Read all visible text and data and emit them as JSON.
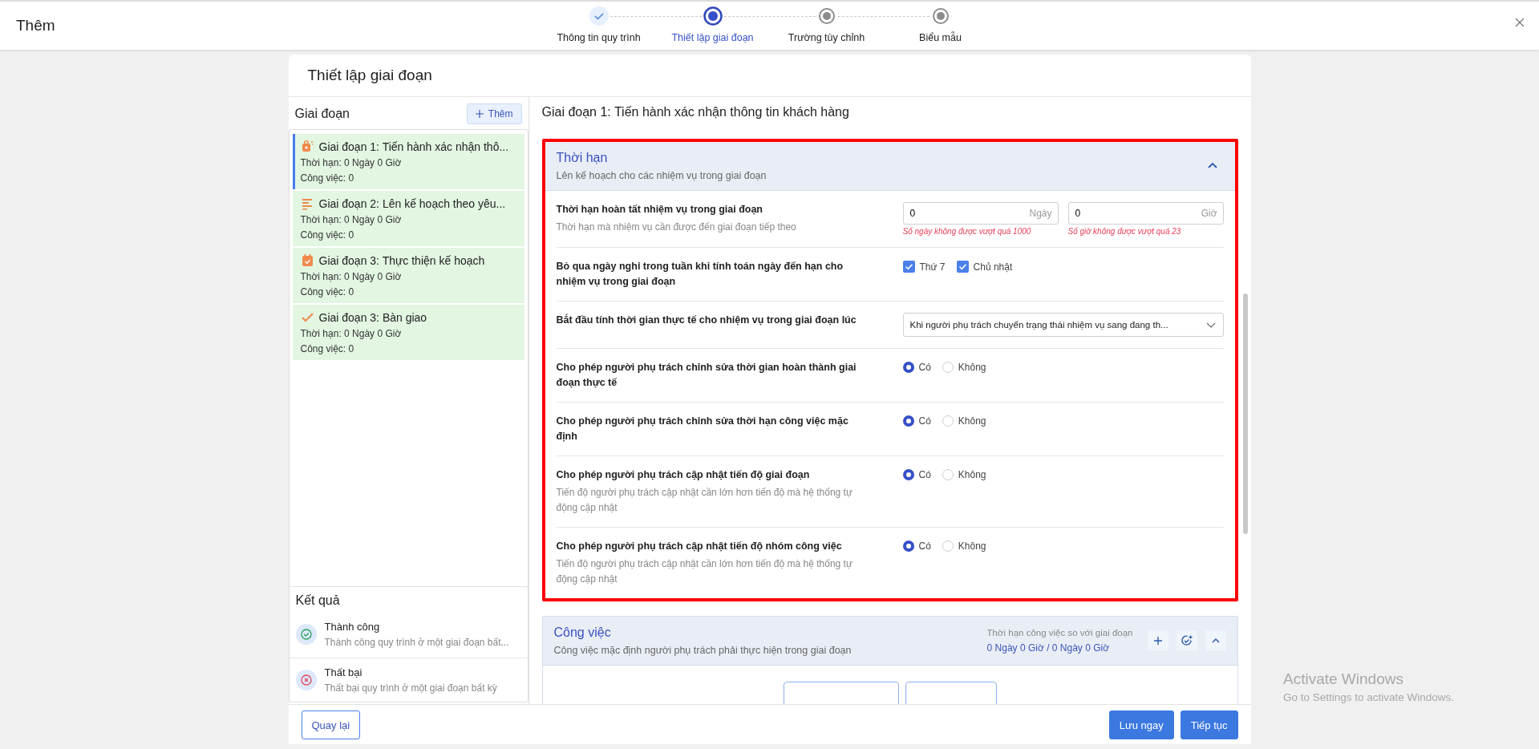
{
  "window": {
    "title": "Thêm"
  },
  "stepper": [
    {
      "label": "Thông tin quy trình",
      "kind": "done"
    },
    {
      "label": "Thiết lập giai đoạn",
      "kind": "active"
    },
    {
      "label": "Trường tùy chỉnh",
      "kind": "pending"
    },
    {
      "label": "Biểu mẫu",
      "kind": "pending"
    }
  ],
  "page_title": "Thiết lập giai đoạn",
  "stages_panel": {
    "title": "Giai đoạn",
    "add_button": "Thêm",
    "stages": [
      {
        "kind": "bag",
        "title": "Giai đoạn 1: Tiến hành xác nhận thô...",
        "duration": "Thời hạn: 0 Ngày 0 Giờ",
        "tasks": "Công việc: 0",
        "selected": true
      },
      {
        "kind": "list",
        "title": "Giai đoạn 2: Lên kế hoạch theo yêu...",
        "duration": "Thời hạn: 0 Ngày 0 Giờ",
        "tasks": "Công việc: 0",
        "selected": false
      },
      {
        "kind": "calendar",
        "title": "Giai đoạn 3: Thực thiện kế hoạch",
        "duration": "Thời hạn: 0 Ngày 0 Giờ",
        "tasks": "Công việc: 0",
        "selected": false
      },
      {
        "kind": "check",
        "title": "Giai đoạn 3: Bàn giao",
        "duration": "Thời hạn: 0 Ngày 0 Giờ",
        "tasks": "Công việc: 0",
        "selected": false
      }
    ]
  },
  "results": {
    "title": "Kết quả",
    "items": [
      {
        "kind": "success",
        "title": "Thành công",
        "description": "Thành công quy trình ở một giai đoạn bất..."
      },
      {
        "kind": "failure",
        "title": "Thất bại",
        "description": "Thất bại quy trình ở một giai đoạn bất kỳ"
      }
    ]
  },
  "detail": {
    "title": "Giai đoạn 1: Tiến hành xác nhận thông tin khách hàng",
    "deadline_section": {
      "title": "Thời hạn",
      "subtitle": "Lên kế hoạch cho các nhiệm vụ trong giai đoạn",
      "expanded": true,
      "highlighted": true,
      "rows": [
        {
          "kind": "inputs",
          "label": "Thời hạn hoàn tất nhiệm vụ trong giai đoạn",
          "hint": "Thời hạn mà nhiệm vụ cần được đến giai đoạn tiếp theo",
          "inputs": [
            {
              "value": "0",
              "unit": "Ngày",
              "error": "Số ngày không được vượt quá 1000"
            },
            {
              "value": "0",
              "unit": "Giờ",
              "error": "Số giờ không được vượt quá 23"
            }
          ]
        },
        {
          "kind": "checkboxes",
          "label": "Bỏ qua ngày nghỉ trong tuần khi tính toán ngày đến hạn cho nhiệm vụ trong giai đoạn",
          "options": [
            {
              "label": "Thứ 7",
              "checked": true
            },
            {
              "label": "Chủ nhật",
              "checked": true
            }
          ]
        },
        {
          "kind": "select",
          "label": "Bắt đầu tính thời gian thực tế cho nhiệm vụ trong giai đoạn lúc",
          "value": "Khi người phụ trách chuyển trạng thái nhiệm vụ sang đang th..."
        },
        {
          "kind": "radios",
          "label": "Cho phép người phụ trách chỉnh sửa thời gian hoàn thành giai đoạn thực tế",
          "options": [
            {
              "label": "Có",
              "selected": true
            },
            {
              "label": "Không",
              "selected": false
            }
          ]
        },
        {
          "kind": "radios",
          "label": "Cho phép người phụ trách chỉnh sửa thời hạn công việc mặc định",
          "options": [
            {
              "label": "Có",
              "selected": true
            },
            {
              "label": "Không",
              "selected": false
            }
          ]
        },
        {
          "kind": "radios",
          "label": "Cho phép người phụ trách cập nhật tiến độ giai đoạn",
          "hint": "Tiến độ người phụ trách cập nhật cần lớn hơn tiến độ mà hệ thống tự động cập nhật",
          "options": [
            {
              "label": "Có",
              "selected": true
            },
            {
              "label": "Không",
              "selected": false
            }
          ]
        },
        {
          "kind": "radios",
          "label": "Cho phép người phụ trách cập nhật tiến độ nhóm công việc",
          "hint": "Tiến độ người phụ trách cập nhật cần lớn hơn tiến độ mà hệ thống tự động cập nhật",
          "options": [
            {
              "label": "Có",
              "selected": true
            },
            {
              "label": "Không",
              "selected": false
            }
          ]
        }
      ]
    },
    "tasks_section": {
      "title": "Công việc",
      "subtitle": "Công việc mặc định người phụ trách phải thực hiện trong giai đoạn",
      "expanded": true,
      "deadline_label": "Thời hạn công việc so với giai đoạn",
      "deadline_value": "0 Ngày 0 Giờ / 0 Ngày 0 Giờ"
    }
  },
  "footer": {
    "back_button": "Quay lại",
    "save_button": "Lưu ngay",
    "next_button": "Tiếp tục"
  },
  "os_notice": {
    "title": "Activate Windows",
    "subtitle": "Go to Settings to activate Windows."
  }
}
